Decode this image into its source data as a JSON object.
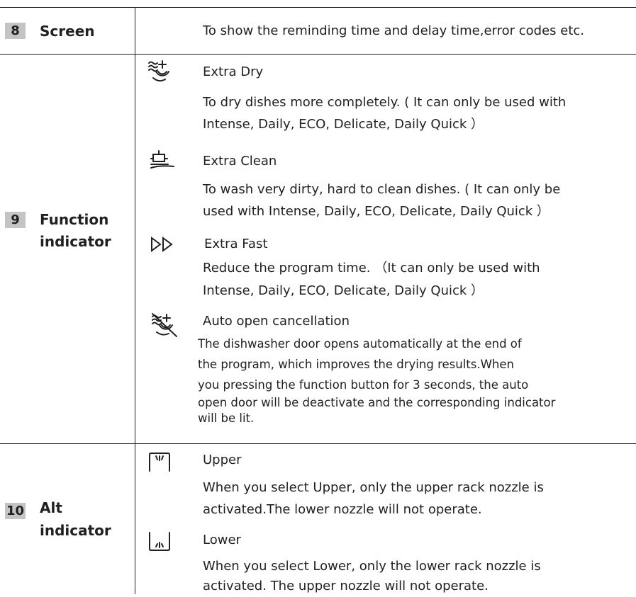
{
  "rows": [
    {
      "number": "8",
      "label": "Screen",
      "description": "To show the reminding time and delay time,error codes etc."
    },
    {
      "number": "9",
      "label_line1": "Function",
      "label_line2": "indicator",
      "items": [
        {
          "icon": "extra-dry-icon",
          "title": "Extra Dry",
          "desc_line1": "To dry dishes more completely. ( It can only be used with",
          "desc_line2": "Intense, Daily, ECO, Delicate, Daily Quick ）"
        },
        {
          "icon": "extra-clean-icon",
          "title": "Extra Clean",
          "desc_line1": "To wash very dirty, hard to clean dishes. ( It can only be",
          "desc_line2": "used with Intense, Daily, ECO, Delicate, Daily Quick ）"
        },
        {
          "icon": "extra-fast-icon",
          "title": "Extra Fast",
          "desc_line1": "Reduce the program time. （It can only be used with",
          "desc_line2": "Intense, Daily, ECO, Delicate, Daily Quick ）"
        },
        {
          "icon": "auto-open-cancellation-icon",
          "title": "Auto open cancellation",
          "desc_lines": [
            "The dishwasher door opens automatically at the end of",
            "the program, which improves the drying results.When",
            "you pressing the function button for 3 seconds, the auto",
            "open door will be deactivate and the corresponding indicator",
            "will be lit."
          ]
        }
      ]
    },
    {
      "number": "10",
      "label_line1": "Alt",
      "label_line2": "indicator",
      "items": [
        {
          "icon": "upper-rack-icon",
          "title": "Upper",
          "desc_line1": "When you select Upper, only the upper rack nozzle is",
          "desc_line2": "activated.The lower nozzle will not operate."
        },
        {
          "icon": "lower-rack-icon",
          "title": "Lower",
          "desc_line1": "When you select Lower, only the lower rack nozzle is",
          "desc_line2": "activated. The upper nozzle will not operate."
        }
      ]
    }
  ]
}
